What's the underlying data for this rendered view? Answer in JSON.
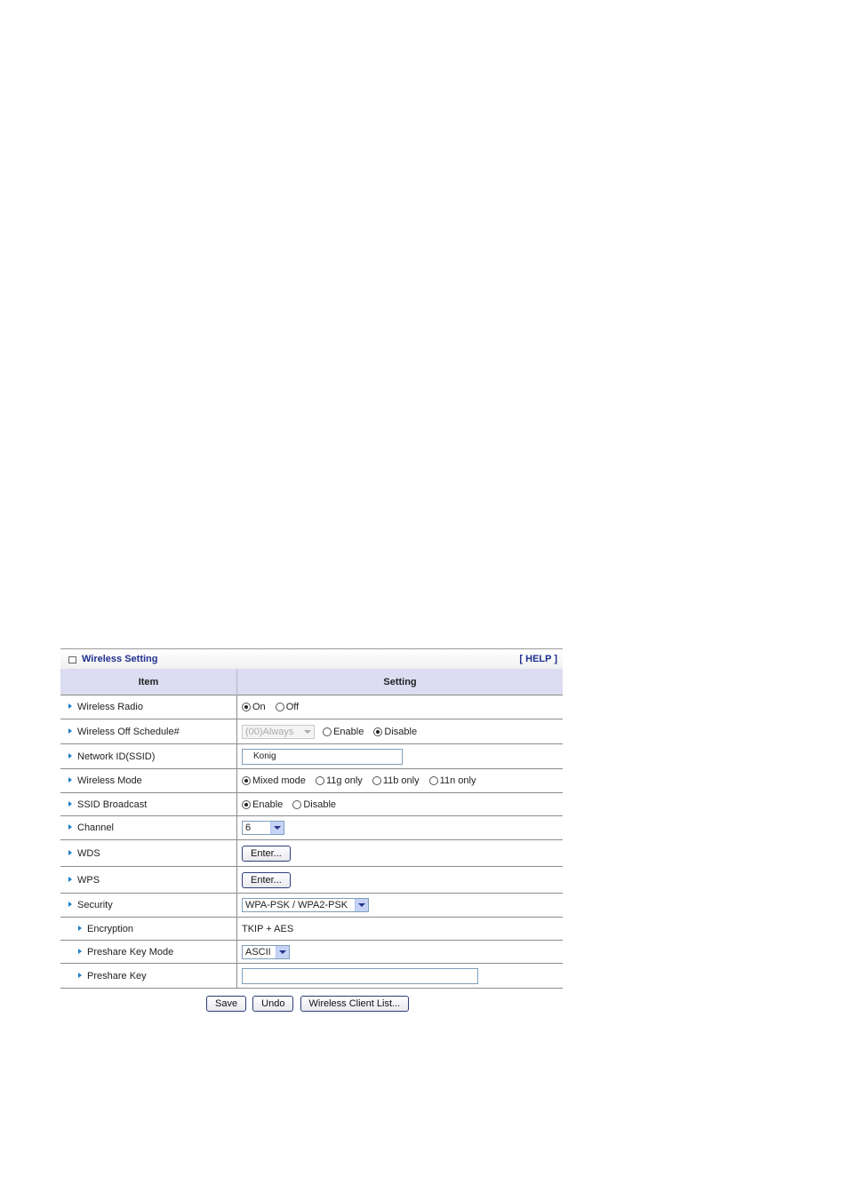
{
  "panel": {
    "title": "Wireless Setting",
    "help": "[ HELP ]",
    "col_item": "Item",
    "col_setting": "Setting"
  },
  "rows": {
    "radio": {
      "label": "Wireless Radio",
      "on": "On",
      "off": "Off"
    },
    "schedule": {
      "label": "Wireless Off Schedule#",
      "select": "(00)Always",
      "enable": "Enable",
      "disable": "Disable"
    },
    "ssid": {
      "label": "Network ID(SSID)",
      "value": "Konig"
    },
    "mode": {
      "label": "Wireless Mode",
      "mixed": "Mixed mode",
      "g": "11g only",
      "b": "11b only",
      "n": "11n only"
    },
    "broadcast": {
      "label": "SSID Broadcast",
      "enable": "Enable",
      "disable": "Disable"
    },
    "channel": {
      "label": "Channel",
      "value": "6"
    },
    "wds": {
      "label": "WDS",
      "button": "Enter..."
    },
    "wps": {
      "label": "WPS",
      "button": "Enter..."
    },
    "security": {
      "label": "Security",
      "value": "WPA-PSK / WPA2-PSK"
    },
    "encryption": {
      "label": "Encryption",
      "value": "TKIP + AES"
    },
    "keymode": {
      "label": "Preshare Key Mode",
      "value": "ASCII"
    },
    "key": {
      "label": "Preshare Key",
      "value": ""
    }
  },
  "buttons": {
    "save": "Save",
    "undo": "Undo",
    "client_list": "Wireless Client List..."
  }
}
